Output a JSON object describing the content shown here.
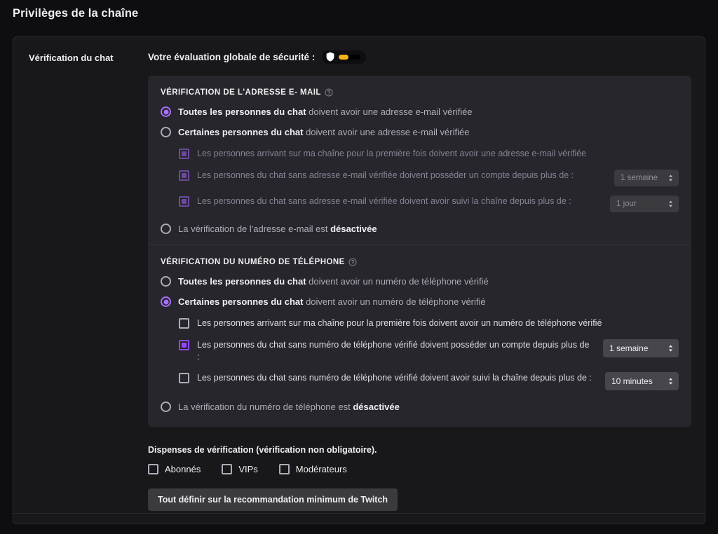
{
  "page": {
    "title": "Privilèges de la chaîne"
  },
  "section": {
    "label": "Vérification du chat",
    "overall_label": "Votre évaluation globale de sécurité :",
    "rating": {
      "icon": "shield-icon",
      "fill_percent": 45,
      "bar_color": "#f5b31b",
      "track_color": "#000000"
    }
  },
  "email_block": {
    "title": "VÉRIFICATION DE L'ADRESSE E- MAIL",
    "help_icon": "help-circle-icon",
    "radios": [
      {
        "id": "email-all",
        "strong": "Toutes les personnes du chat",
        "rest": " doivent avoir une adresse e-mail vérifiée",
        "checked": true
      },
      {
        "id": "email-some",
        "strong": "Certaines personnes du chat",
        "rest": " doivent avoir une adresse e-mail vérifiée",
        "checked": false
      }
    ],
    "sub_options": [
      {
        "id": "email-first-time",
        "text": "Les personnes arrivant sur ma chaîne pour la première fois doivent avoir une adresse e-mail vérifiée",
        "state": "checked-disabled",
        "select": null
      },
      {
        "id": "email-account-age",
        "text": "Les personnes du chat sans adresse e-mail vérifiée doivent posséder un compte depuis plus de :",
        "state": "checked-disabled",
        "select": {
          "value": "1 semaine"
        }
      },
      {
        "id": "email-follow-age",
        "text": "Les personnes du chat sans adresse e-mail vérifiée doivent avoir suivi la chaîne depuis plus de :",
        "state": "checked-disabled",
        "select": {
          "value": "1 jour"
        }
      }
    ],
    "disabled_radio": {
      "id": "email-off",
      "rest": "La vérification de l'adresse e-mail est ",
      "strong": "désactivée",
      "checked": false
    }
  },
  "phone_block": {
    "title": "VÉRIFICATION DU NUMÉRO DE TÉLÉPHONE",
    "help_icon": "help-circle-icon",
    "radios": [
      {
        "id": "phone-all",
        "strong": "Toutes les personnes du chat",
        "rest": " doivent avoir un numéro de téléphone vérifié",
        "checked": false
      },
      {
        "id": "phone-some",
        "strong": "Certaines personnes du chat",
        "rest": " doivent avoir un numéro de téléphone vérifié",
        "checked": true
      }
    ],
    "sub_options": [
      {
        "id": "phone-first-time",
        "text": "Les personnes arrivant sur ma chaîne pour la première fois doivent avoir un numéro de téléphone vérifié",
        "state": "unchecked",
        "select": null
      },
      {
        "id": "phone-account-age",
        "text": "Les personnes du chat sans numéro de téléphone vérifié doivent posséder un compte depuis plus de :",
        "state": "checked",
        "select": {
          "value": "1 semaine"
        }
      },
      {
        "id": "phone-follow-age",
        "text": "Les personnes du chat sans numéro de téléphone vérifié doivent avoir suivi la chaîne depuis plus de :",
        "state": "unchecked",
        "select": {
          "value": "10 minutes"
        }
      }
    ],
    "disabled_radio": {
      "id": "phone-off",
      "rest": "La vérification du numéro de téléphone est ",
      "strong": "désactivée",
      "checked": false
    }
  },
  "exemptions": {
    "title": "Dispenses de vérification (vérification non obligatoire).",
    "items": [
      {
        "id": "exempt-subs",
        "label": "Abonnés",
        "checked": false
      },
      {
        "id": "exempt-vips",
        "label": "VIPs",
        "checked": false
      },
      {
        "id": "exempt-mods",
        "label": "Modérateurs",
        "checked": false
      }
    ],
    "button_label": "Tout définir sur la recommandation minimum de Twitch"
  },
  "colors": {
    "accent_purple": "#9147ff",
    "accent_purple_dim": "#6b4a9e",
    "radio_purple": "#a970ff",
    "rating_orange": "#f5b31b",
    "page_bg": "#0e0e10",
    "card_bg": "#18181b",
    "panel_bg": "#26262c"
  }
}
